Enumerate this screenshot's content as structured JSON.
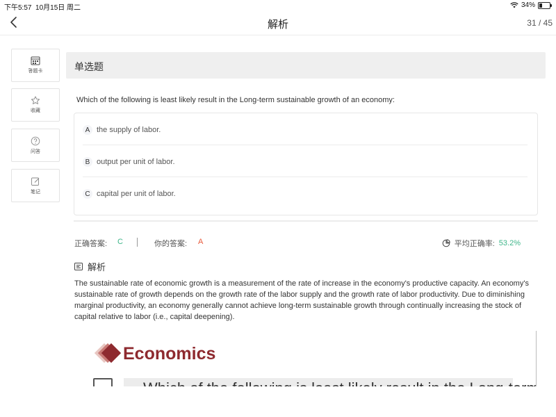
{
  "status_bar": {
    "time": "下午5:57",
    "date": "10月15日 周二",
    "battery": "34%"
  },
  "nav": {
    "title": "解析",
    "page_counter": "31 / 45"
  },
  "sidebar": {
    "items": [
      {
        "label": "答题卡",
        "icon": "answer-card-icon"
      },
      {
        "label": "收藏",
        "icon": "star-icon"
      },
      {
        "label": "问答",
        "icon": "question-icon"
      },
      {
        "label": "笔记",
        "icon": "note-icon"
      }
    ]
  },
  "question": {
    "type": "单选题",
    "text": "Which of the following is least likely result in the Long-term sustainable growth of an economy:",
    "options": [
      {
        "letter": "A",
        "text": "the supply of labor."
      },
      {
        "letter": "B",
        "text": "output per unit of labor."
      },
      {
        "letter": "C",
        "text": "capital per unit of labor."
      }
    ]
  },
  "answer": {
    "correct_label": "正确答案:",
    "correct_value": "C",
    "your_label": "你的答案:",
    "your_value": "A",
    "avg_label": "平均正确率:",
    "avg_value": "53.2%"
  },
  "analysis": {
    "heading": "解析",
    "text": "The sustainable rate of economic growth is a measurement of the rate of increase in the economy's productive capacity. An economy's sustainable rate of growth depends on the growth rate of the labor supply and the growth rate of labor productivity. Due to diminishing marginal productivity, an economy generally cannot achieve long-term sustainable growth through continually increasing the stock of capital relative to labor (i.e., capital deepening)."
  },
  "embedded_image": {
    "title": "Economics",
    "question_fragment": "Which of the following is least likely result in the Long-term sustainable"
  },
  "colors": {
    "correct": "#3fb68a",
    "wrong": "#e85a3c",
    "brand": "#8e2a2f"
  }
}
